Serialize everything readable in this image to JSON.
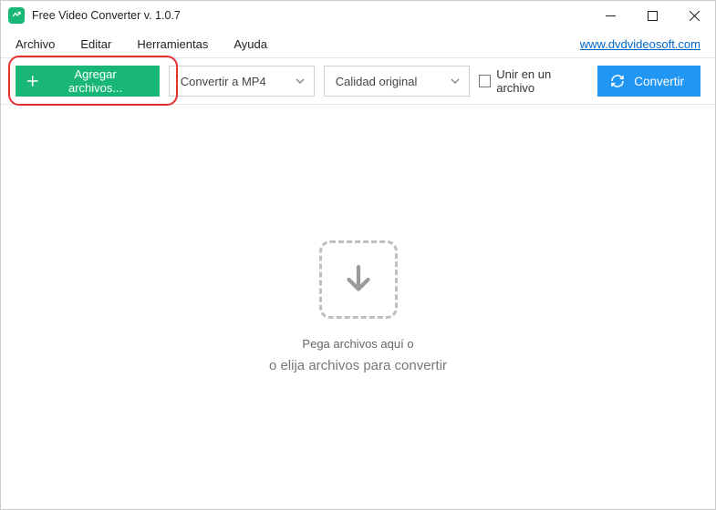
{
  "titlebar": {
    "title": "Free Video Converter v. 1.0.7"
  },
  "menu": {
    "items": [
      "Archivo",
      "Editar",
      "Herramientas",
      "Ayuda"
    ],
    "link_text": "www.dvdvideosoft.com"
  },
  "toolbar": {
    "add_label": "Agregar archivos...",
    "format_selected": "Convertir a MP4",
    "quality_selected": "Calidad original",
    "merge_label": "Unir en un archivo",
    "convert_label": "Convertir"
  },
  "dropzone": {
    "line1": "Pega archivos aquí o",
    "line2": "o elija archivos para convertir"
  }
}
